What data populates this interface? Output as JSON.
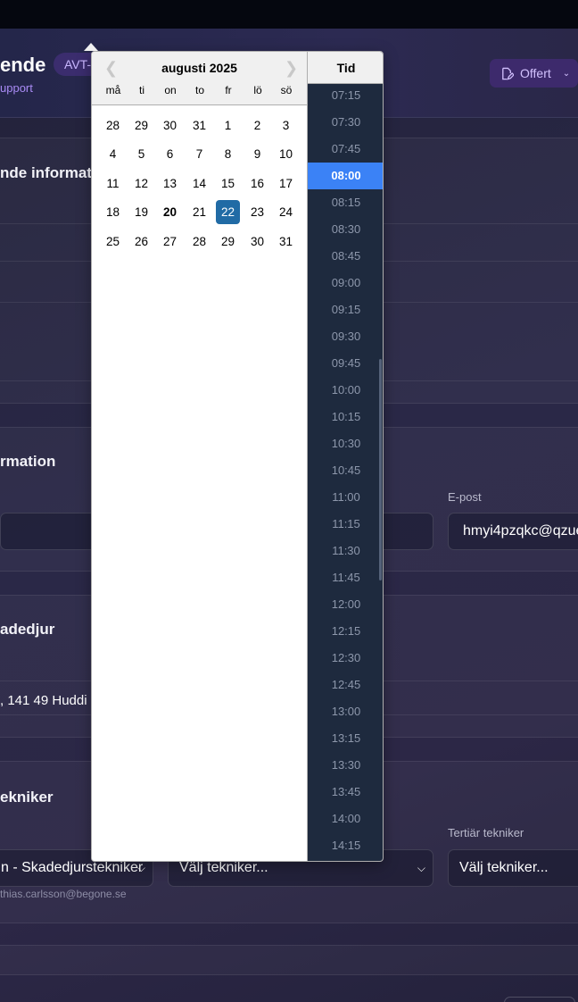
{
  "header": {
    "title_fragment": "ende",
    "case_badge": "AVT-",
    "support_link": "upport",
    "offer_button": "Offert"
  },
  "sections": {
    "s1_title": "nde informat",
    "s2_title": "rmation",
    "email_label": "E-post",
    "email_value": "hmyi4pzqkc@qzue",
    "s3_title": "adedjur",
    "address_text": ", 141 49 Huddi",
    "s4_title": "ekniker",
    "primary_tech_value": "n - Skadedjurstekniker",
    "secondary_tech_value": "Välj tekniker...",
    "tertiary_label": "Tertiär tekniker",
    "tertiary_value": "Välj tekniker...",
    "tech_email": "thias.carlsson@begone.se"
  },
  "datepicker": {
    "month_title": "augusti 2025",
    "weekdays": [
      "må",
      "ti",
      "on",
      "to",
      "fr",
      "lö",
      "sö"
    ],
    "weeks": [
      [
        "28",
        "29",
        "30",
        "31",
        "1",
        "2",
        "3"
      ],
      [
        "4",
        "5",
        "6",
        "7",
        "8",
        "9",
        "10"
      ],
      [
        "11",
        "12",
        "13",
        "14",
        "15",
        "16",
        "17"
      ],
      [
        "18",
        "19",
        "20",
        "21",
        "22",
        "23",
        "24"
      ],
      [
        "25",
        "26",
        "27",
        "28",
        "29",
        "30",
        "31"
      ]
    ],
    "today": "20",
    "selected_day": "22",
    "time_header": "Tid",
    "times": [
      "07:15",
      "07:30",
      "07:45",
      "08:00",
      "08:15",
      "08:30",
      "08:45",
      "09:00",
      "09:15",
      "09:30",
      "09:45",
      "10:00",
      "10:15",
      "10:30",
      "10:45",
      "11:00",
      "11:15",
      "11:30",
      "11:45",
      "12:00",
      "12:15",
      "12:30",
      "12:45",
      "13:00",
      "13:15",
      "13:30",
      "13:45",
      "14:00",
      "14:15"
    ],
    "selected_time": "08:00"
  }
}
